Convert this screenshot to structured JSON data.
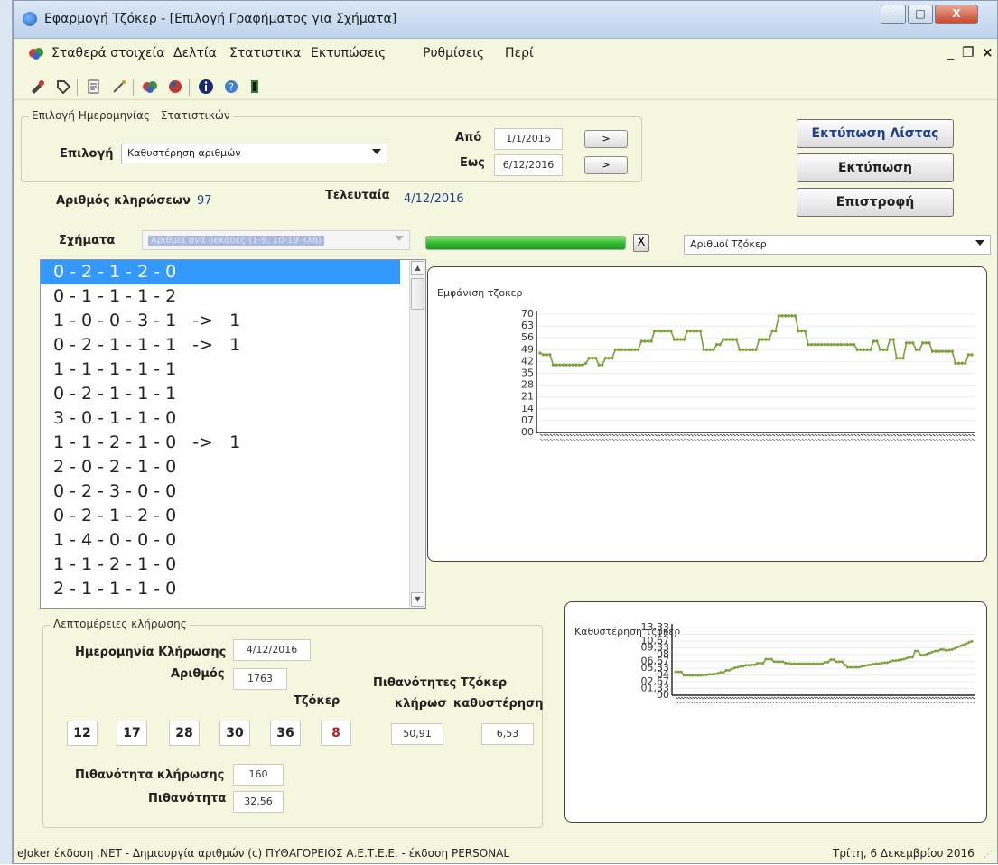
{
  "window": {
    "title": "Εφαρμογή Τζόκερ - [Επιλογή Γραφήματος για Σχήματα]",
    "controls": {
      "minimize": "–",
      "maximize": "□",
      "close": "X"
    }
  },
  "menubar": {
    "items": [
      "Σταθερά στοιχεία",
      "Δελτία",
      "Στατιστικα",
      "Εκτυπώσεις",
      "Ρυθμίσεις",
      "Περί"
    ],
    "mdi_controls": {
      "minimize": "_",
      "restore": "❐",
      "close": "×"
    }
  },
  "toolbar": {
    "icons": [
      "tools-icon",
      "tag-icon",
      "notepad-icon",
      "wand-icon",
      "joker-icon",
      "chart-ball-icon",
      "info-icon",
      "help-icon",
      "exit-icon"
    ]
  },
  "date_group": {
    "title": "Επιλογή Ημερομηνίας - Στατιστικών",
    "select_label": "Επιλογή",
    "select_value": "Καθυστέρηση αριθμών",
    "from_label": "Από",
    "from_value": "1/1/2016",
    "to_label": "Εως",
    "to_value": "6/12/2016",
    "next_button": ">"
  },
  "buttons": {
    "print_list": "Εκτύπωση Λίστας",
    "print": "Εκτύπωση",
    "back": "Επιστροφή"
  },
  "summary": {
    "draws_label": "Αριθμός κληρώσεων",
    "draws_value": "97",
    "last_label": "Τελευταία",
    "last_value": "4/12/2016"
  },
  "shapes": {
    "label": "Σχήματα",
    "value": "Αριθμοί ανά δεκάδες (1-9, 10-19 κλπ)",
    "progress": 1.0,
    "x_button": "X",
    "numbers_select": "Αριθμοί Τζόκερ"
  },
  "patterns": [
    "0 - 2 - 1 - 2 - 0",
    "0 - 1 - 1 - 1 - 2",
    "1 - 0 - 0 - 3 - 1   ->   1",
    "0 - 2 - 1 - 1 - 1   ->   1",
    "1 - 1 - 1 - 1 - 1",
    "0 - 2 - 1 - 1 - 1",
    "3 - 0 - 1 - 1 - 0",
    "1 - 1 - 2 - 1 - 0   ->   1",
    "2 - 0 - 2 - 1 - 0",
    "0 - 2 - 3 - 0 - 0",
    "0 - 2 - 1 - 2 - 0",
    "1 - 4 - 0 - 0 - 0",
    "1 - 1 - 2 - 1 - 0",
    "2 - 1 - 1 - 1 - 0"
  ],
  "details": {
    "title": "Λεπτομέρειες κλήρωσης",
    "date_label": "Ημερομηνία Κλήρωσης",
    "date_value": "4/12/2016",
    "number_label": "Αριθμός",
    "number_value": "1763",
    "numbers": [
      "12",
      "17",
      "28",
      "30",
      "36"
    ],
    "joker_label": "Τζόκερ",
    "joker_value": "8",
    "prob_title": "Πιθανότητες Τζόκερ",
    "prob_draw_label": "κλήρωσ",
    "prob_delay_label": "καθυστέρηση",
    "prob_draw_value": "50,91",
    "prob_delay_value": "6,53",
    "draw_prob_label": "Πιθανότητα κλήρωσης",
    "draw_prob_value": "160",
    "prob_label": "Πιθανότητα",
    "prob_value": "32,56"
  },
  "chart_data": [
    {
      "type": "line",
      "title": "Εμφάνιση τζοκερ",
      "ylim": [
        0,
        70
      ],
      "yticks": [
        "00",
        "07",
        "14",
        "21",
        "28",
        "35",
        "42",
        "49",
        "56",
        "63",
        "70"
      ],
      "color": "#7ea13a",
      "values": [
        47,
        46,
        46,
        46,
        40,
        40,
        40,
        40,
        40,
        40,
        40,
        40,
        40,
        40,
        41,
        44,
        44,
        44,
        40,
        40,
        44,
        44,
        44,
        49,
        49,
        49,
        49,
        49,
        49,
        49,
        49,
        54,
        54,
        54,
        54,
        60,
        60,
        60,
        60,
        60,
        60,
        55,
        55,
        55,
        55,
        60,
        60,
        60,
        60,
        60,
        49,
        49,
        49,
        49,
        52,
        52,
        55,
        55,
        55,
        55,
        55,
        49,
        49,
        49,
        49,
        49,
        49,
        55,
        55,
        55,
        55,
        60,
        60,
        69,
        69,
        69,
        69,
        69,
        69,
        60,
        60,
        60,
        52,
        52,
        52,
        52,
        52,
        52,
        52,
        52,
        52,
        52,
        52,
        52,
        52,
        52,
        52,
        49,
        49,
        49,
        49,
        49,
        54,
        54,
        49,
        49,
        49,
        55,
        55,
        44,
        44,
        44,
        53,
        53,
        53,
        49,
        49,
        53,
        53,
        53,
        48,
        48,
        48,
        48,
        48,
        48,
        48,
        41,
        41,
        41,
        41,
        46,
        46
      ]
    },
    {
      "type": "line",
      "title": "Καθυστέρηση τζοκερ",
      "ylim": [
        0,
        13.33
      ],
      "yticks": [
        "00",
        "01,33",
        "02,67",
        "04",
        "05,33",
        "06,67",
        "08",
        "09,33",
        "10,67",
        "12",
        "13,33"
      ],
      "color": "#7ea13a",
      "values": [
        4.6,
        4.6,
        4.6,
        3.9,
        3.9,
        3.9,
        3.9,
        3.9,
        3.9,
        3.9,
        4.0,
        4.0,
        4.1,
        4.1,
        4.2,
        4.3,
        4.5,
        4.5,
        4.9,
        4.9,
        5.2,
        5.4,
        5.5,
        5.7,
        5.7,
        5.9,
        5.9,
        6.0,
        6.0,
        6.3,
        6.3,
        6.3,
        7.1,
        7.1,
        7.1,
        6.6,
        6.6,
        6.6,
        6.6,
        6.3,
        6.3,
        6.2,
        6.2,
        6.2,
        6.2,
        6.2,
        6.2,
        6.2,
        6.2,
        6.2,
        6.2,
        6.2,
        6.2,
        6.5,
        6.5,
        7.0,
        7.0,
        6.6,
        6.6,
        6.6,
        6.0,
        5.5,
        5.5,
        5.5,
        5.5,
        5.5,
        5.7,
        5.8,
        5.9,
        6.0,
        6.1,
        6.2,
        6.2,
        6.3,
        6.4,
        6.4,
        6.6,
        6.8,
        6.8,
        6.9,
        7.0,
        7.1,
        7.3,
        7.5,
        7.5,
        8.7,
        8.7,
        7.9,
        7.9,
        8.1,
        8.3,
        8.5,
        8.7,
        8.7,
        9.0,
        9.0,
        8.8,
        8.9,
        9.0,
        9.2,
        9.5,
        9.7,
        9.9,
        10.1,
        10.4,
        10.6
      ]
    }
  ],
  "statusbar": {
    "left": "eJoker έκδοση .NET  - Δημιουργία αριθμών  (c) ΠΥΘΑΓΟΡΕΙΟΣ  Α.Ε.Τ.Ε.Ε.  - έκδοση PERSONAL",
    "right": "Τρίτη, 6 Δεκεμβρίου 2016"
  }
}
